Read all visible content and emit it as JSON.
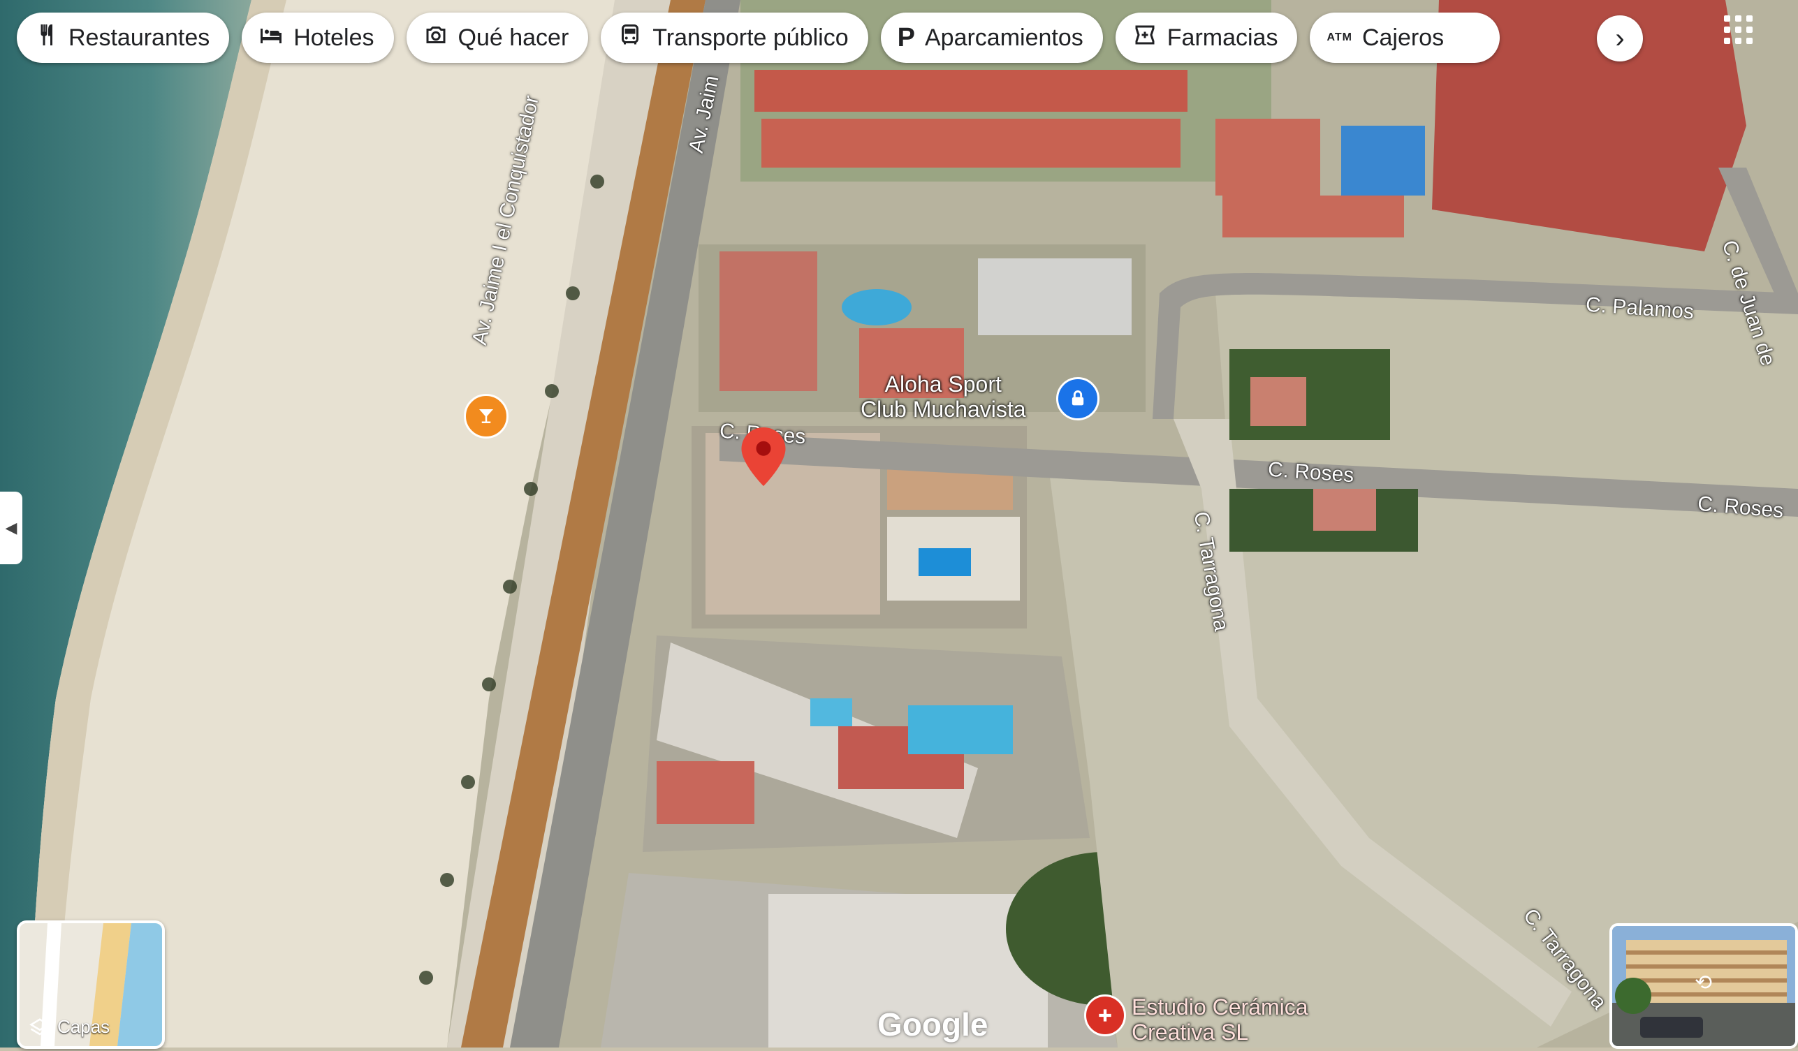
{
  "categories": [
    {
      "label": "Restaurantes",
      "icon": "fork-knife-icon"
    },
    {
      "label": "Hoteles",
      "icon": "bed-icon"
    },
    {
      "label": "Qué hacer",
      "icon": "camera-icon"
    },
    {
      "label": "Transporte público",
      "icon": "bus-icon"
    },
    {
      "label": "Aparcamientos",
      "icon": "parking-icon"
    },
    {
      "label": "Farmacias",
      "icon": "pharmacy-icon"
    },
    {
      "label": "Cajeros",
      "icon": "atm-icon"
    }
  ],
  "atm_badge": "ATM",
  "parking_letter": "P",
  "layers_label": "Capas",
  "brand": "Google",
  "streets": {
    "jaime_a": "Av. Jaime I el Conquistador",
    "jaime_b": "Av. Jaim",
    "roses_a": "C. Roses",
    "roses_b": "C. Roses",
    "roses_c": "C. Roses",
    "palamos": "C. Palamos",
    "juan": "C. de Juan de",
    "tarragona_a": "C. Tarragona",
    "tarragona_b": "C. Tarragona"
  },
  "pois": {
    "aloha_line1": "Aloha Sport",
    "aloha_line2": "Club Muchavista",
    "estudio_line1": "Estudio Cerámica",
    "estudio_line2": "Creativa SL"
  },
  "colors": {
    "pin": "#ea4335",
    "beach_bar": "#f28b1e",
    "sport_poi": "#1a73e8",
    "health_poi": "#d93025"
  }
}
